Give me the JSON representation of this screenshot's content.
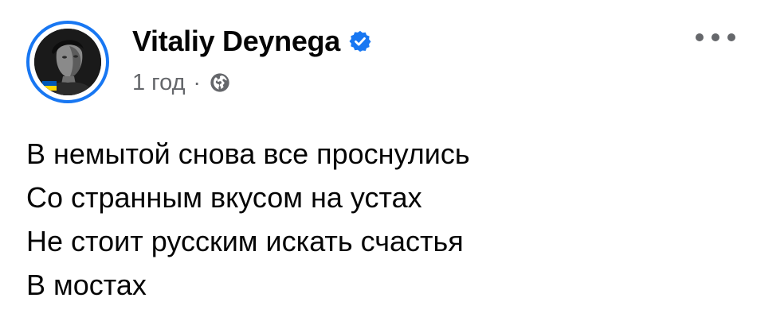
{
  "post": {
    "author": {
      "name": "Vitaliy Deynega",
      "verified": true,
      "avatar_alt": "profile photo"
    },
    "meta": {
      "time": "1 год",
      "separator": "·",
      "audience_icon": "globe-icon"
    },
    "more_icon": "more-horizontal-icon",
    "lines": [
      "В немытой снова все проснулись",
      "Со странным вкусом на устах",
      "Не стоит русским искать счастья",
      "В мостах"
    ]
  },
  "colors": {
    "accent": "#1877f2",
    "text": "#050505",
    "secondary_text": "#65676b",
    "flag_blue": "#0057b7",
    "flag_yellow": "#ffd700"
  }
}
